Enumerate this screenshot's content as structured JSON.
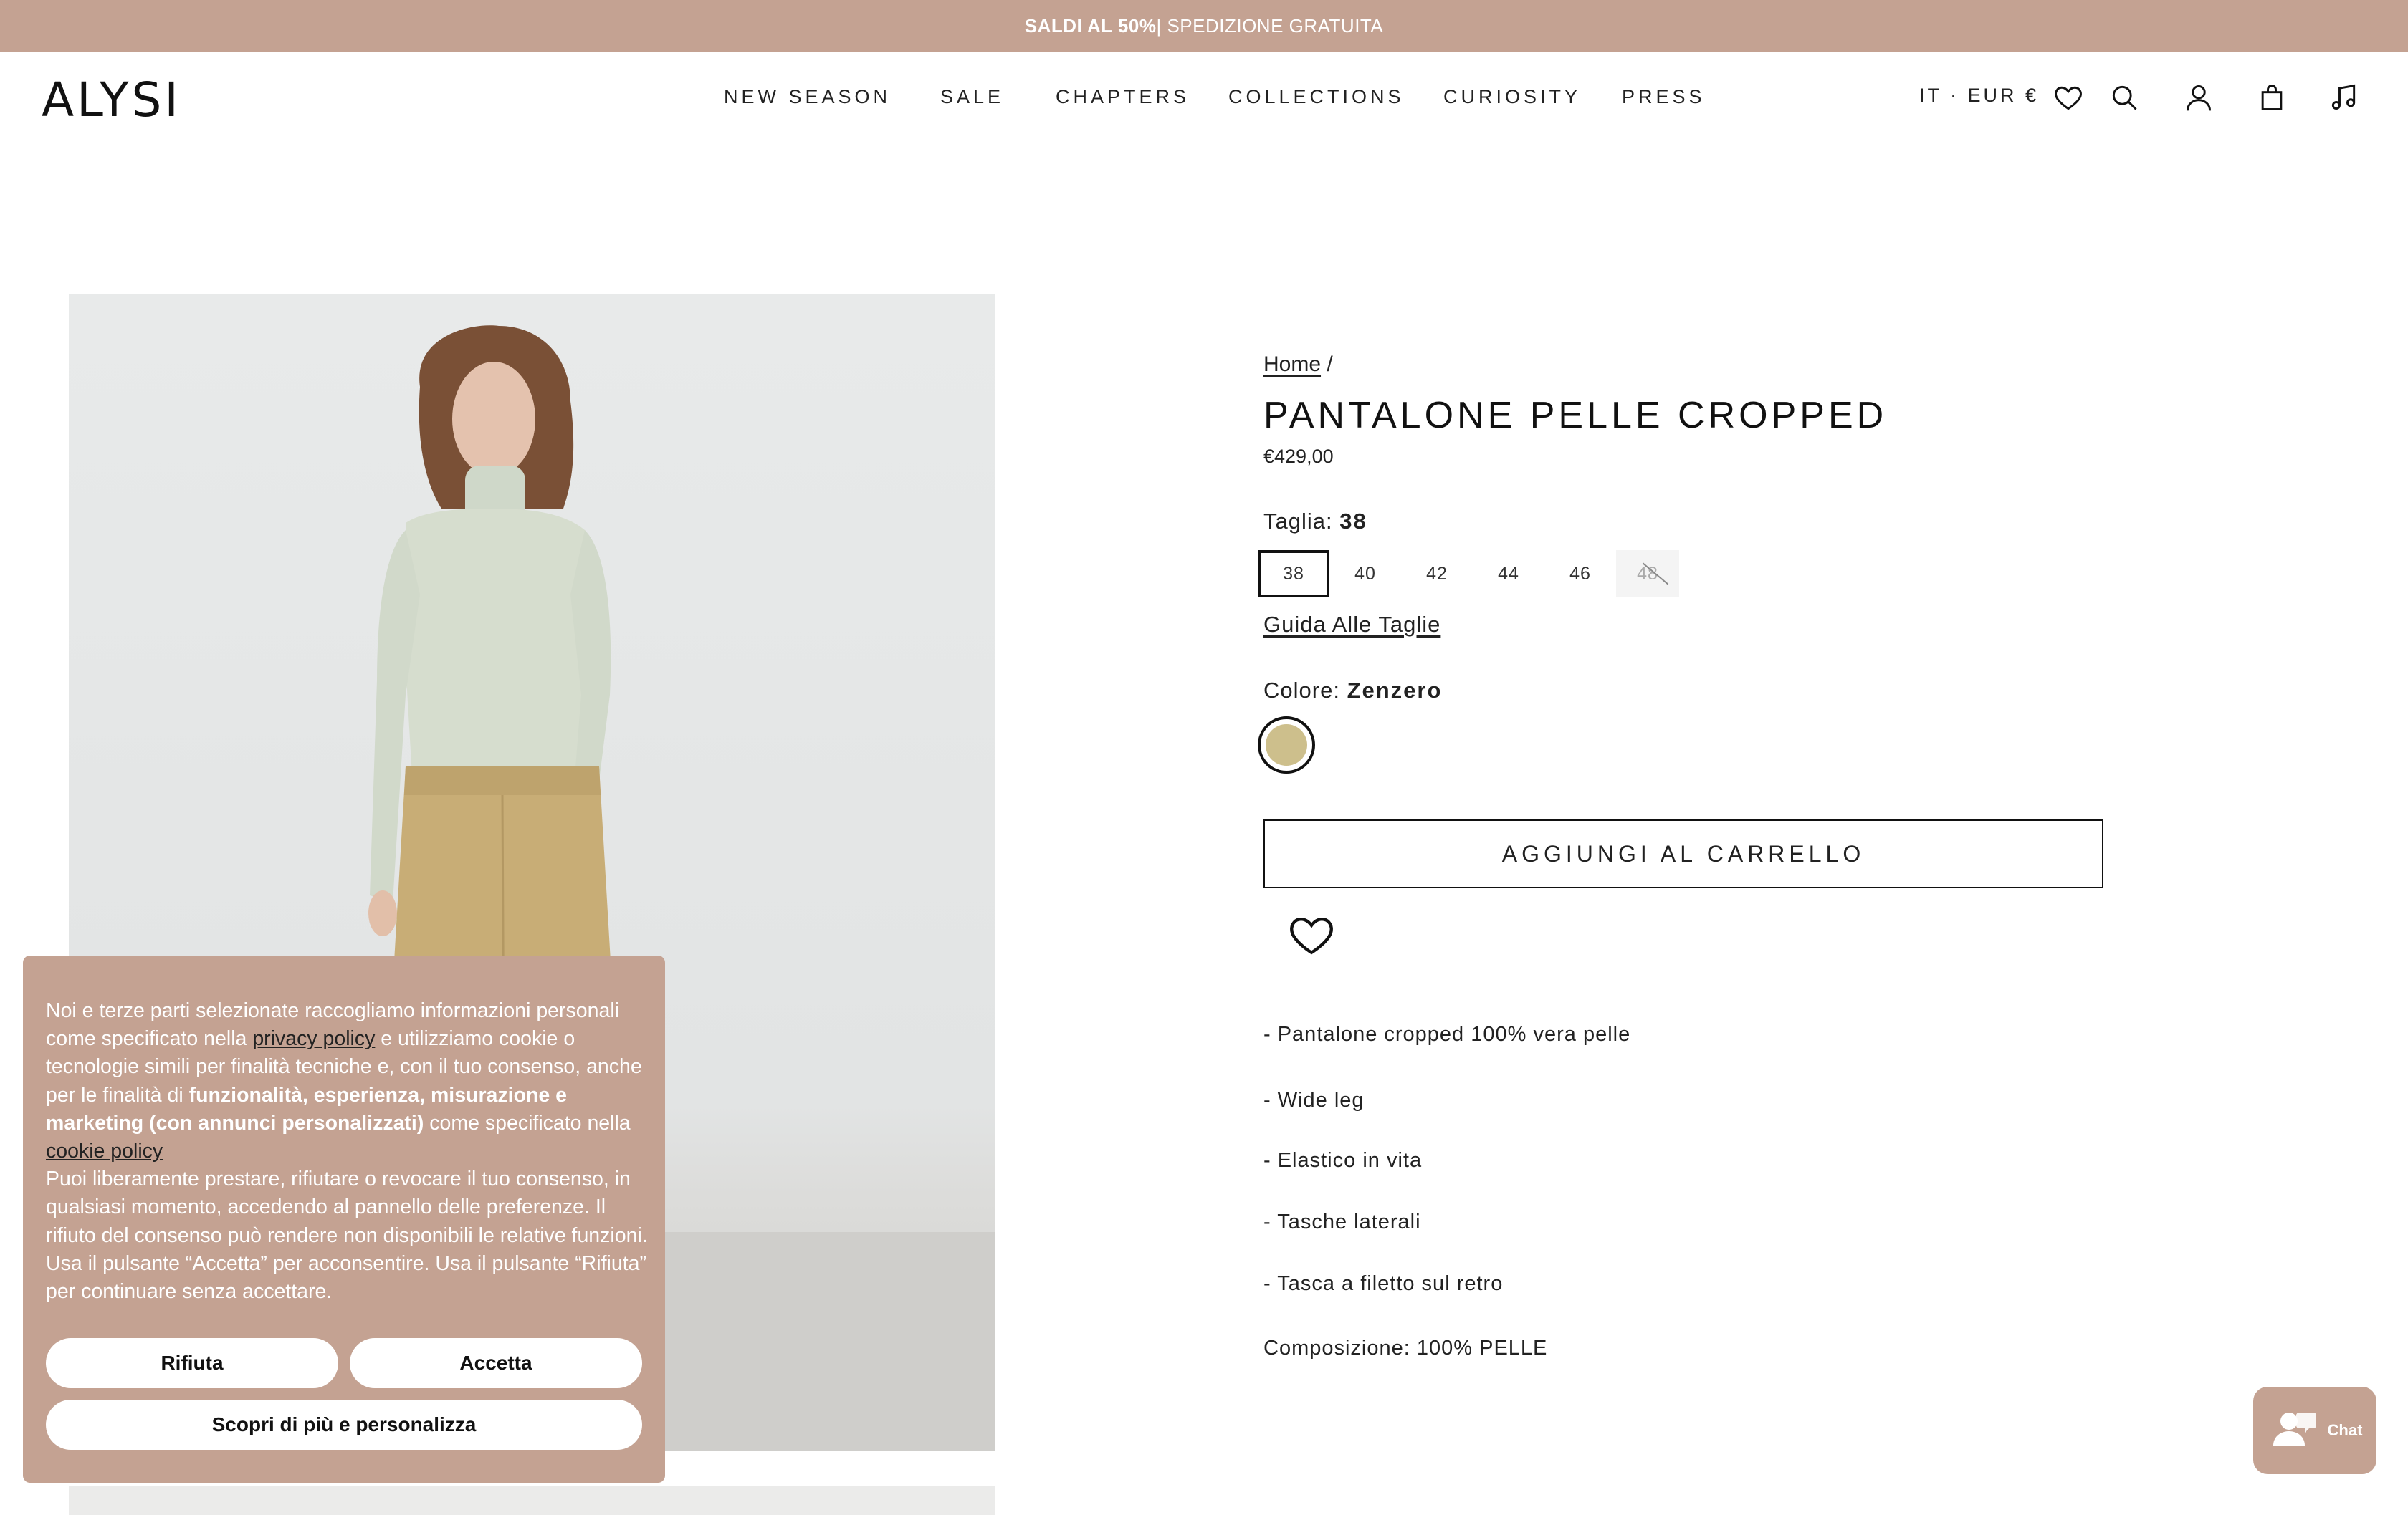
{
  "announcement": {
    "bold": "SALDI AL 50%",
    "rest": "| SPEDIZIONE GRATUITA"
  },
  "header": {
    "logo": "ALYSI",
    "nav": [
      "NEW SEASON",
      "SALE",
      "CHAPTERS",
      "COLLECTIONS",
      "CURIOSITY",
      "PRESS"
    ],
    "locale": "IT · EUR €",
    "icons": [
      "heart-icon",
      "search-icon",
      "account-icon",
      "bag-icon",
      "music-icon"
    ]
  },
  "product": {
    "breadcrumb_home": "Home",
    "breadcrumb_sep": "/",
    "title": "PANTALONE PELLE CROPPED",
    "price": "€429,00",
    "size_label": "Taglia:",
    "size_selected": "38",
    "sizes": [
      "38",
      "40",
      "42",
      "44",
      "46",
      "48"
    ],
    "size_guide": "Guida Alle Taglie",
    "color_label": "Colore:",
    "color_selected": "Zenzero",
    "swatch_color": "#cdbf8c",
    "add_to_cart": "AGGIUNGI AL CARRELLO",
    "features": [
      "- Pantalone cropped 100% vera pelle",
      "- Wide leg",
      "- Elastico in vita",
      "- Tasche laterali",
      "- Tasca a filetto sul retro",
      "Composizione: 100% PELLE"
    ]
  },
  "cookie": {
    "p1_a": "Noi e terze parti selezionate raccogliamo informazioni personali come specificato nella ",
    "privacy_link": "privacy policy",
    "p1_b": " e utilizziamo cookie o tecnologie simili per finalità tecniche e, con il tuo consenso, anche per le finalità di ",
    "p1_bold": "funzionalità, esperienza, misurazione e marketing (con annunci personalizzati)",
    "p1_c": " come specificato nella ",
    "cookie_link": "cookie policy",
    "p2": "Puoi liberamente prestare, rifiutare o revocare il tuo consenso, in qualsiasi momento, accedendo al pannello delle preferenze. Il rifiuto del consenso può rendere non disponibili le relative funzioni. Usa il pulsante “Accetta” per acconsentire. Usa il pulsante “Rifiuta” per continuare senza accettare.",
    "reject": "Rifiuta",
    "accept": "Accetta",
    "customize": "Scopri di più e personalizza"
  },
  "chat": {
    "label": "Chat"
  },
  "colors": {
    "accent": "#c4a292",
    "text": "#111111"
  }
}
